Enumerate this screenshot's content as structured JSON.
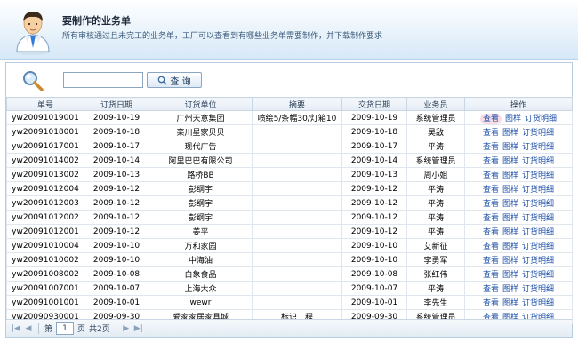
{
  "header": {
    "title": "要制作的业务单",
    "description": "所有审核通过且未完工的业务单，工厂可以查看到有哪些业务单需要制作，并下载制作要求"
  },
  "search": {
    "button_label": "查 询",
    "value": ""
  },
  "table": {
    "columns": [
      "单号",
      "订货日期",
      "订货单位",
      "摘要",
      "交货日期",
      "业务员",
      "操作"
    ],
    "actions": {
      "view": "查看",
      "image": "图样",
      "detail": "订货明细"
    },
    "rows": [
      {
        "no": "yw20091019001",
        "order_date": "2009-10-19",
        "unit": "广州天意集团",
        "summary": "喷绘5/条幅30/灯箱10",
        "delivery_date": "2009-10-19",
        "salesman": "系统管理员"
      },
      {
        "no": "yw20091018001",
        "order_date": "2009-10-18",
        "unit": "栾川星家贝贝",
        "summary": "",
        "delivery_date": "2009-10-18",
        "salesman": "吴敌"
      },
      {
        "no": "yw20091017001",
        "order_date": "2009-10-17",
        "unit": "现代广告",
        "summary": "",
        "delivery_date": "2009-10-17",
        "salesman": "平涛"
      },
      {
        "no": "yw20091014002",
        "order_date": "2009-10-14",
        "unit": "阿里巴巴有限公司",
        "summary": "",
        "delivery_date": "2009-10-14",
        "salesman": "系统管理员"
      },
      {
        "no": "yw20091013002",
        "order_date": "2009-10-13",
        "unit": "路桥BB",
        "summary": "",
        "delivery_date": "2009-10-13",
        "salesman": "周小姐"
      },
      {
        "no": "yw20091012004",
        "order_date": "2009-10-12",
        "unit": "彭纲宇",
        "summary": "",
        "delivery_date": "2009-10-12",
        "salesman": "平涛"
      },
      {
        "no": "yw20091012003",
        "order_date": "2009-10-12",
        "unit": "彭纲宇",
        "summary": "",
        "delivery_date": "2009-10-12",
        "salesman": "平涛"
      },
      {
        "no": "yw20091012002",
        "order_date": "2009-10-12",
        "unit": "彭纲宇",
        "summary": "",
        "delivery_date": "2009-10-12",
        "salesman": "平涛"
      },
      {
        "no": "yw20091012001",
        "order_date": "2009-10-12",
        "unit": "姜平",
        "summary": "",
        "delivery_date": "2009-10-12",
        "salesman": "平涛"
      },
      {
        "no": "yw20091010004",
        "order_date": "2009-10-10",
        "unit": "万和家园",
        "summary": "",
        "delivery_date": "2009-10-10",
        "salesman": "艾新征"
      },
      {
        "no": "yw20091010002",
        "order_date": "2009-10-10",
        "unit": "中海油",
        "summary": "",
        "delivery_date": "2009-10-10",
        "salesman": "李勇军"
      },
      {
        "no": "yw20091008002",
        "order_date": "2009-10-08",
        "unit": "白象食品",
        "summary": "",
        "delivery_date": "2009-10-08",
        "salesman": "张红伟"
      },
      {
        "no": "yw20091007001",
        "order_date": "2009-10-07",
        "unit": "上海大众",
        "summary": "",
        "delivery_date": "2009-10-07",
        "salesman": "平涛"
      },
      {
        "no": "yw20091001001",
        "order_date": "2009-10-01",
        "unit": "wewr",
        "summary": "",
        "delivery_date": "2009-10-01",
        "salesman": "李先生"
      },
      {
        "no": "yw20090930001",
        "order_date": "2009-09-30",
        "unit": "爱家家居家具城",
        "summary": "标识工程",
        "delivery_date": "2009-09-30",
        "salesman": "系统管理员"
      }
    ]
  },
  "pager": {
    "page_label": "第",
    "page_value": "1",
    "page_unit": "页",
    "total_label": "共2页"
  }
}
